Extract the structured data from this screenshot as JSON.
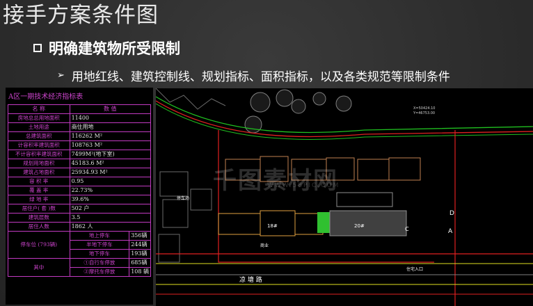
{
  "slide": {
    "title": "接手方案条件图",
    "heading": "明确建筑物所受限制",
    "subbullet": "用地红线、建筑控制线、规划指标、面积指标，以及各类规范等限制条件"
  },
  "spec_table": {
    "title": "A区一期技术经济指标表",
    "header": [
      "名 称",
      "数 值"
    ],
    "rows": [
      [
        "房地总总用地面积",
        "11400"
      ],
      [
        "土地用途",
        "商住用地"
      ],
      [
        "总建筑面积",
        "116262 M²"
      ],
      [
        "计容积率建筑面积",
        "108763 M²"
      ],
      [
        "不计容积率建筑面积",
        "7499M²(地下室)"
      ],
      [
        "规划用地面积",
        "45183.6 M²"
      ],
      [
        "建筑占地面积",
        "25934.93 M²"
      ],
      [
        "容 积 率",
        "0.95"
      ],
      [
        "覆 盖 率",
        "22.73%"
      ],
      [
        "绿 地 率",
        "39.6%"
      ],
      [
        "居住户( 套 )数",
        "502 户"
      ],
      [
        "建筑层数",
        "3.5"
      ],
      [
        "居住人数",
        "1862 人"
      ]
    ],
    "parking_label": "停车位 (793辆)",
    "parking_rows": [
      [
        "地上停车",
        "356辆"
      ],
      [
        "半地下停车",
        "244辆"
      ],
      [
        "地下停车",
        "193辆"
      ]
    ],
    "other_label": "其中",
    "other_rows": [
      [
        "①自行车停放",
        "685辆"
      ],
      [
        "②摩托车停放",
        "108 辆"
      ]
    ]
  },
  "site_plan": {
    "labels": [
      "18#",
      "20#",
      "D",
      "A",
      "C",
      "凉 塘 路",
      "停车场",
      "商业",
      "住宅入口",
      "X=50424.10",
      "Y=46753.00"
    ],
    "watermark": "千图素材网",
    "watermark_url": "WWW.58PIC.COM"
  }
}
